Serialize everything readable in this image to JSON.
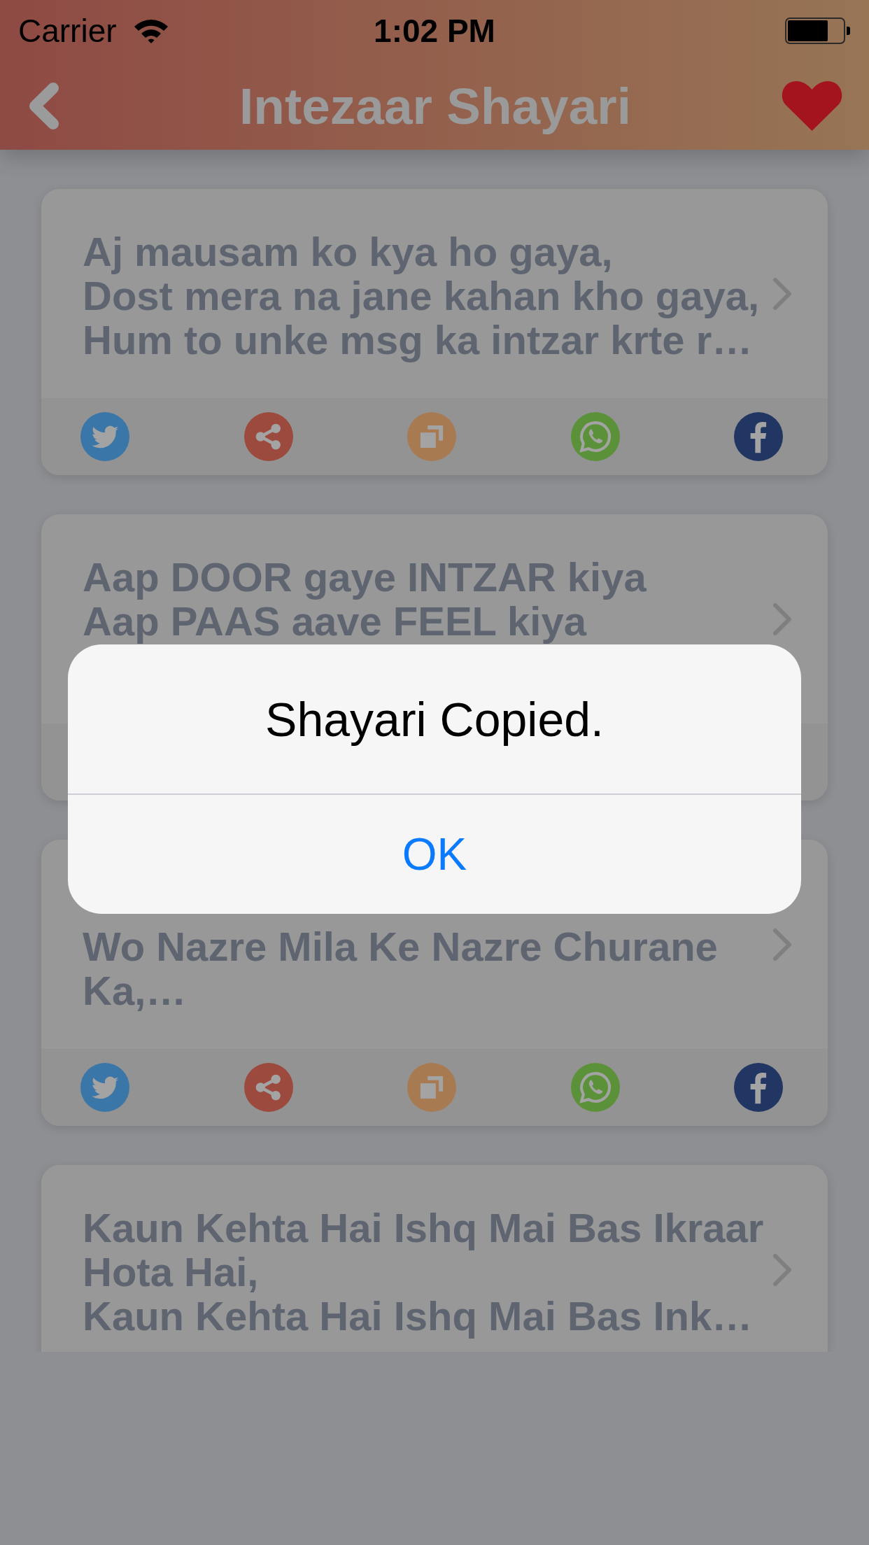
{
  "status_bar": {
    "carrier": "Carrier",
    "time": "1:02 PM"
  },
  "nav_bar": {
    "title": "Intezaar Shayari"
  },
  "cards": [
    {
      "lines": [
        "Aj mausam ko kya ho gaya,",
        "Dost mera na jane kahan kho gaya,",
        "Hum to unke msg ka intzar krte r…"
      ],
      "first_line_covered": false,
      "share_bar": true
    },
    {
      "lines": [
        "Aap DOOR gaye INTZAR kiya",
        "Aap PAAS aave FEEL kiya"
      ],
      "first_line_covered": false
    },
    {
      "lines": [
        "Wo Nazre Mila Ke Nazre Churane",
        "Ka,…"
      ],
      "first_line_covered": true,
      "share_bar": true
    },
    {
      "lines": [
        "Kaun Kehta Hai Ishq Mai Bas Ikraar",
        "Hota Hai,",
        "Kaun Kehta Hai Ishq Mai Bas Ink…"
      ],
      "first_line_covered": false
    }
  ],
  "alert": {
    "message": "Shayari Copied.",
    "button": "OK"
  }
}
